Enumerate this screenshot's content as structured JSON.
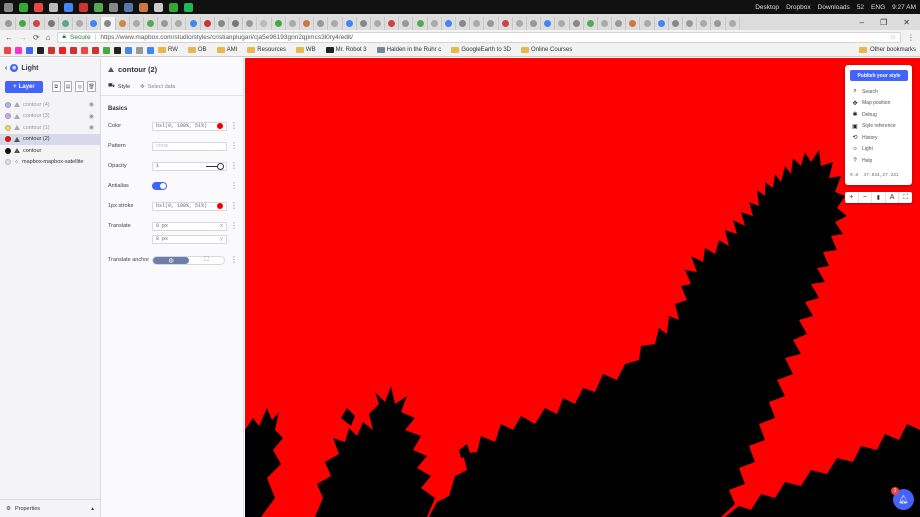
{
  "taskbar": {
    "tray_items": [
      "Desktop",
      "Dropbox",
      "Downloads",
      "ENG"
    ],
    "battery": "52",
    "time": "9:27 AM",
    "icon_colors": [
      "#888888",
      "#3a3",
      "#e44",
      "#bbb",
      "#4285f4",
      "#c33",
      "#5a5",
      "#888",
      "#57a",
      "#c74",
      "#ccc",
      "#3a3",
      "#1db954"
    ]
  },
  "browser": {
    "window_controls": [
      "–",
      "❐",
      "✕"
    ],
    "secure_label": "Secure",
    "url": "https://www.mapbox.com/studio/styles/cristianplugari/cja5e96193gnn2qpmcs3l0ry4/edit/",
    "bookmarks": [
      {
        "label": "RW",
        "color": "#e8b84a"
      },
      {
        "label": "OB",
        "color": "#e8b84a"
      },
      {
        "label": "AMI",
        "color": "#e8b84a"
      },
      {
        "label": "Resources",
        "color": "#e8b84a"
      },
      {
        "label": "WB",
        "color": "#e8b84a"
      },
      {
        "label": "Mr. Robot 3",
        "color": "#222"
      },
      {
        "label": "Halden in the Ruhr c",
        "color": "#789"
      },
      {
        "label": "GoogleEarth to 3D",
        "color": "#e8b84a"
      },
      {
        "label": "Online Courses",
        "color": "#e8b84a"
      }
    ],
    "other_bookmarks": "Other bookmarks"
  },
  "left_panel": {
    "style_name": "Light",
    "layer_button": "Layer",
    "layers": [
      {
        "name": "contour (4)",
        "color": "#a9b6e8",
        "dim": true
      },
      {
        "name": "contour (3)",
        "color": "#c9a8e8",
        "dim": true
      },
      {
        "name": "contour (1)",
        "color": "#f3d36b",
        "dim": true
      },
      {
        "name": "contour (2)",
        "color": "#ee1111",
        "dim": false,
        "selected": true
      },
      {
        "name": "contour",
        "color": "#111111",
        "dim": false
      },
      {
        "name": "mapbox-mapbox-satellite",
        "color": "#dddddd",
        "dim": false
      }
    ],
    "footer": "Properties"
  },
  "editor": {
    "layer_title": "contour (2)",
    "tab_style": "Style",
    "tab_select_data": "Select data",
    "section": "Basics",
    "props": {
      "color_label": "Color",
      "color_value": "hsl(0, 100%, 51%)",
      "pattern_label": "Pattern",
      "pattern_placeholder": "none",
      "opacity_label": "Opacity",
      "opacity_value": "1",
      "antialias_label": "Antialias",
      "stroke_label": "1px stroke",
      "stroke_value": "hsl(0, 100%, 51%)",
      "translate_label": "Translate",
      "translate_x": "0 px",
      "translate_y": "0 px",
      "translate_x_tag": "x",
      "translate_y_tag": "y",
      "anchor_label": "Translate anchor"
    }
  },
  "map_panel": {
    "publish_label": "Publish your style",
    "menu": [
      {
        "label": "Search",
        "icon": "search-icon",
        "glyph": "⌕"
      },
      {
        "label": "Map position",
        "icon": "crosshair-icon",
        "glyph": "✥"
      },
      {
        "label": "Debug",
        "icon": "bug-icon",
        "glyph": "✱"
      },
      {
        "label": "Style reference",
        "icon": "book-icon",
        "glyph": "▣"
      },
      {
        "label": "History",
        "icon": "history-icon",
        "glyph": "⟲"
      },
      {
        "label": "Light",
        "icon": "sun-icon",
        "glyph": "☼"
      },
      {
        "label": "Help",
        "icon": "help-icon",
        "glyph": "?"
      }
    ],
    "zoom": "9.8",
    "coords": "47.534,27.331",
    "zoom_controls": [
      "+",
      "−",
      "⬍",
      "A",
      "⛶"
    ],
    "help_badge": "1"
  }
}
